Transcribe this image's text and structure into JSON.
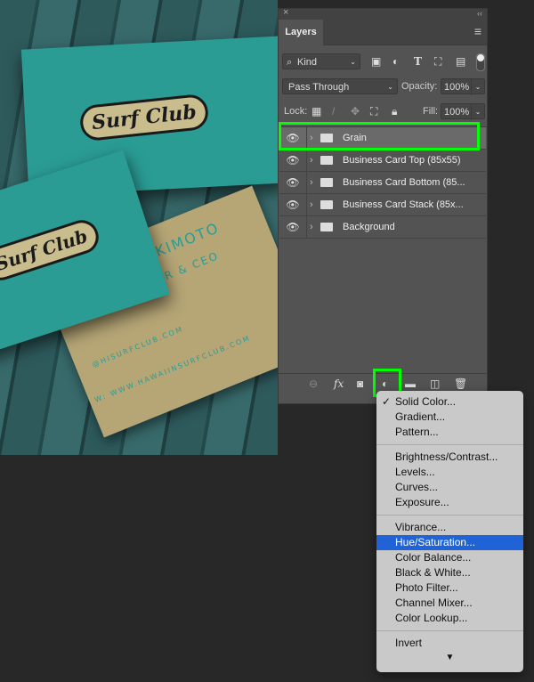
{
  "photo": {
    "logo_text": "Surf Club",
    "name": "AKIMOTO",
    "title": "WNER & CEO",
    "email": "@HISURFCLUB.COM",
    "web": "W: WWW.HAWAIINSURFCLUB.COM"
  },
  "panel": {
    "close": "×",
    "collapse": "‹‹",
    "tab": "Layers",
    "menu": "≡",
    "filter": {
      "value": "Kind",
      "icons": [
        "image-filter-icon",
        "adjustment-filter-icon",
        "type-filter-icon",
        "shape-filter-icon",
        "smart-object-filter-icon"
      ]
    },
    "blend": {
      "value": "Pass Through",
      "opacity_label": "Opacity:",
      "opacity": "100%"
    },
    "lock": {
      "label": "Lock:",
      "fill_label": "Fill:",
      "fill": "100%"
    },
    "layers": [
      {
        "name": "Grain",
        "selected": true
      },
      {
        "name": "Business Card Top (85x55)"
      },
      {
        "name": "Business Card Bottom (85..."
      },
      {
        "name": "Business Card Stack (85x..."
      },
      {
        "name": "Background"
      }
    ],
    "bottom_icons": [
      "link-icon",
      "fx-icon",
      "mask-icon",
      "adjustment-layer-icon",
      "group-icon",
      "new-layer-icon",
      "trash-icon"
    ],
    "fx": "fx"
  },
  "menu": {
    "groups": [
      [
        "Solid Color...",
        "Gradient...",
        "Pattern..."
      ],
      [
        "Brightness/Contrast...",
        "Levels...",
        "Curves...",
        "Exposure..."
      ],
      [
        "Vibrance...",
        "Hue/Saturation...",
        "Color Balance...",
        "Black & White...",
        "Photo Filter...",
        "Channel Mixer...",
        "Color Lookup..."
      ],
      [
        "Invert"
      ]
    ],
    "checked": "Solid Color...",
    "highlighted": "Hue/Saturation...",
    "highlight_color": "#1f63d6",
    "more": "▼"
  },
  "highlight_color": "#00ff00"
}
